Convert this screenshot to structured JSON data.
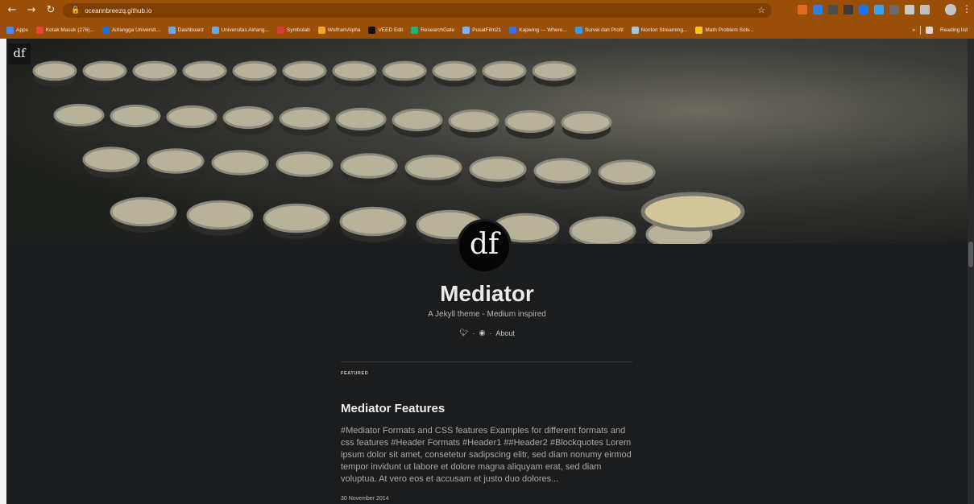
{
  "browser": {
    "url": "oceannbreezq.github.io",
    "bookmarks": [
      {
        "label": "Apps",
        "color": "#4a8bf5"
      },
      {
        "label": "Kotak Masuk (276)...",
        "color": "#ea4335"
      },
      {
        "label": "Airlangga Universit...",
        "color": "#1f6fd1"
      },
      {
        "label": "Dashboard",
        "color": "#6aa7e6"
      },
      {
        "label": "Universitas Airlang...",
        "color": "#6aa7e6"
      },
      {
        "label": "Symbolab",
        "color": "#d93c3c"
      },
      {
        "label": "WolframAlpha",
        "color": "#f4a81e"
      },
      {
        "label": "VEED Edit",
        "color": "#111111"
      },
      {
        "label": "ResearchGate",
        "color": "#25b07a"
      },
      {
        "label": "PusatFilm21",
        "color": "#7db3ff"
      },
      {
        "label": "Kapwing — Where...",
        "color": "#3e6fe0"
      },
      {
        "label": "Survei dan Profil",
        "color": "#3c98e0"
      },
      {
        "label": "Nonton Streaming...",
        "color": "#a4c6d8"
      },
      {
        "label": "Math Problem Solv...",
        "color": "#f5c518"
      }
    ],
    "overflow": "»",
    "reading_list": "Reading list"
  },
  "site": {
    "logo": "df",
    "avatar": "df",
    "title": "Mediator",
    "subtitle": "A Jekyll theme - Medium inspired",
    "links": {
      "twitter_icon": "twitter-icon",
      "github_icon": "github-icon",
      "separator": "·",
      "about": "About"
    }
  },
  "featured": {
    "label": "FEATURED",
    "post_title": "Mediator Features",
    "excerpt": "#Mediator Formats and CSS features Examples for different formats and css features #Header Formats #Header1 ##Header2 #Blockquotes Lorem ipsum dolor sit amet, consetetur sadipscing elitr, sed diam nonumy eirmod tempor invidunt ut labore et dolore magna aliquyam erat, sed diam voluptua. At vero eos et accusam et justo duo dolores...",
    "date": "30 November 2014"
  },
  "colors": {
    "chrome": "#9a4f08",
    "page_bg": "#1b1c1d"
  }
}
